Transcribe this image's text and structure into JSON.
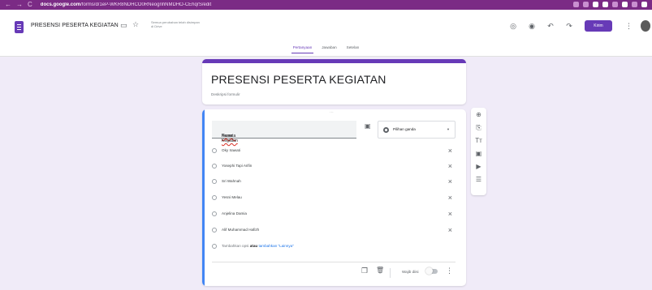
{
  "browser": {
    "url_domain": "docs.google.com",
    "url_path": "/forms/d/1eP-WKR8NDHCO0RNeognhNMDHO-CEhqrS/edit"
  },
  "header": {
    "title": "PRESENSI PESERTA KEGIATAN",
    "saved_note": "Semua perubahan telah disimpan di Drive",
    "send_label": "Kirim",
    "icons": [
      "palette-icon",
      "preview-icon",
      "undo-icon",
      "redo-icon",
      "more-vert-icon"
    ]
  },
  "tabs": [
    {
      "label": "Pertanyaan",
      "active": true
    },
    {
      "label": "Jawaban",
      "active": false
    },
    {
      "label": "Setelan",
      "active": false
    }
  ],
  "form": {
    "title": "PRESENSI PESERTA KEGIATAN",
    "description_placeholder": "Deskripsi formulir"
  },
  "question": {
    "title_prefix": "Nama ",
    "title_underlined": "Peserta Kegiatan",
    "type_label": "Pilihan ganda",
    "options": [
      "Oky Irawati",
      "Yosephi Tapi Arifin",
      "Sri Wahnah",
      "Yesni Melau",
      "Anjelina Damia",
      "Alif Muhammad Hafizh"
    ],
    "add_option": "Tambahkan opsi",
    "or_text": "atau",
    "add_other": "tambahkan \"Lainnya\"",
    "required_label": "Wajib diisi",
    "required": false
  },
  "colors": {
    "accent": "#673ab7",
    "active_card": "#4285f4",
    "background": "#f0ebf8"
  }
}
